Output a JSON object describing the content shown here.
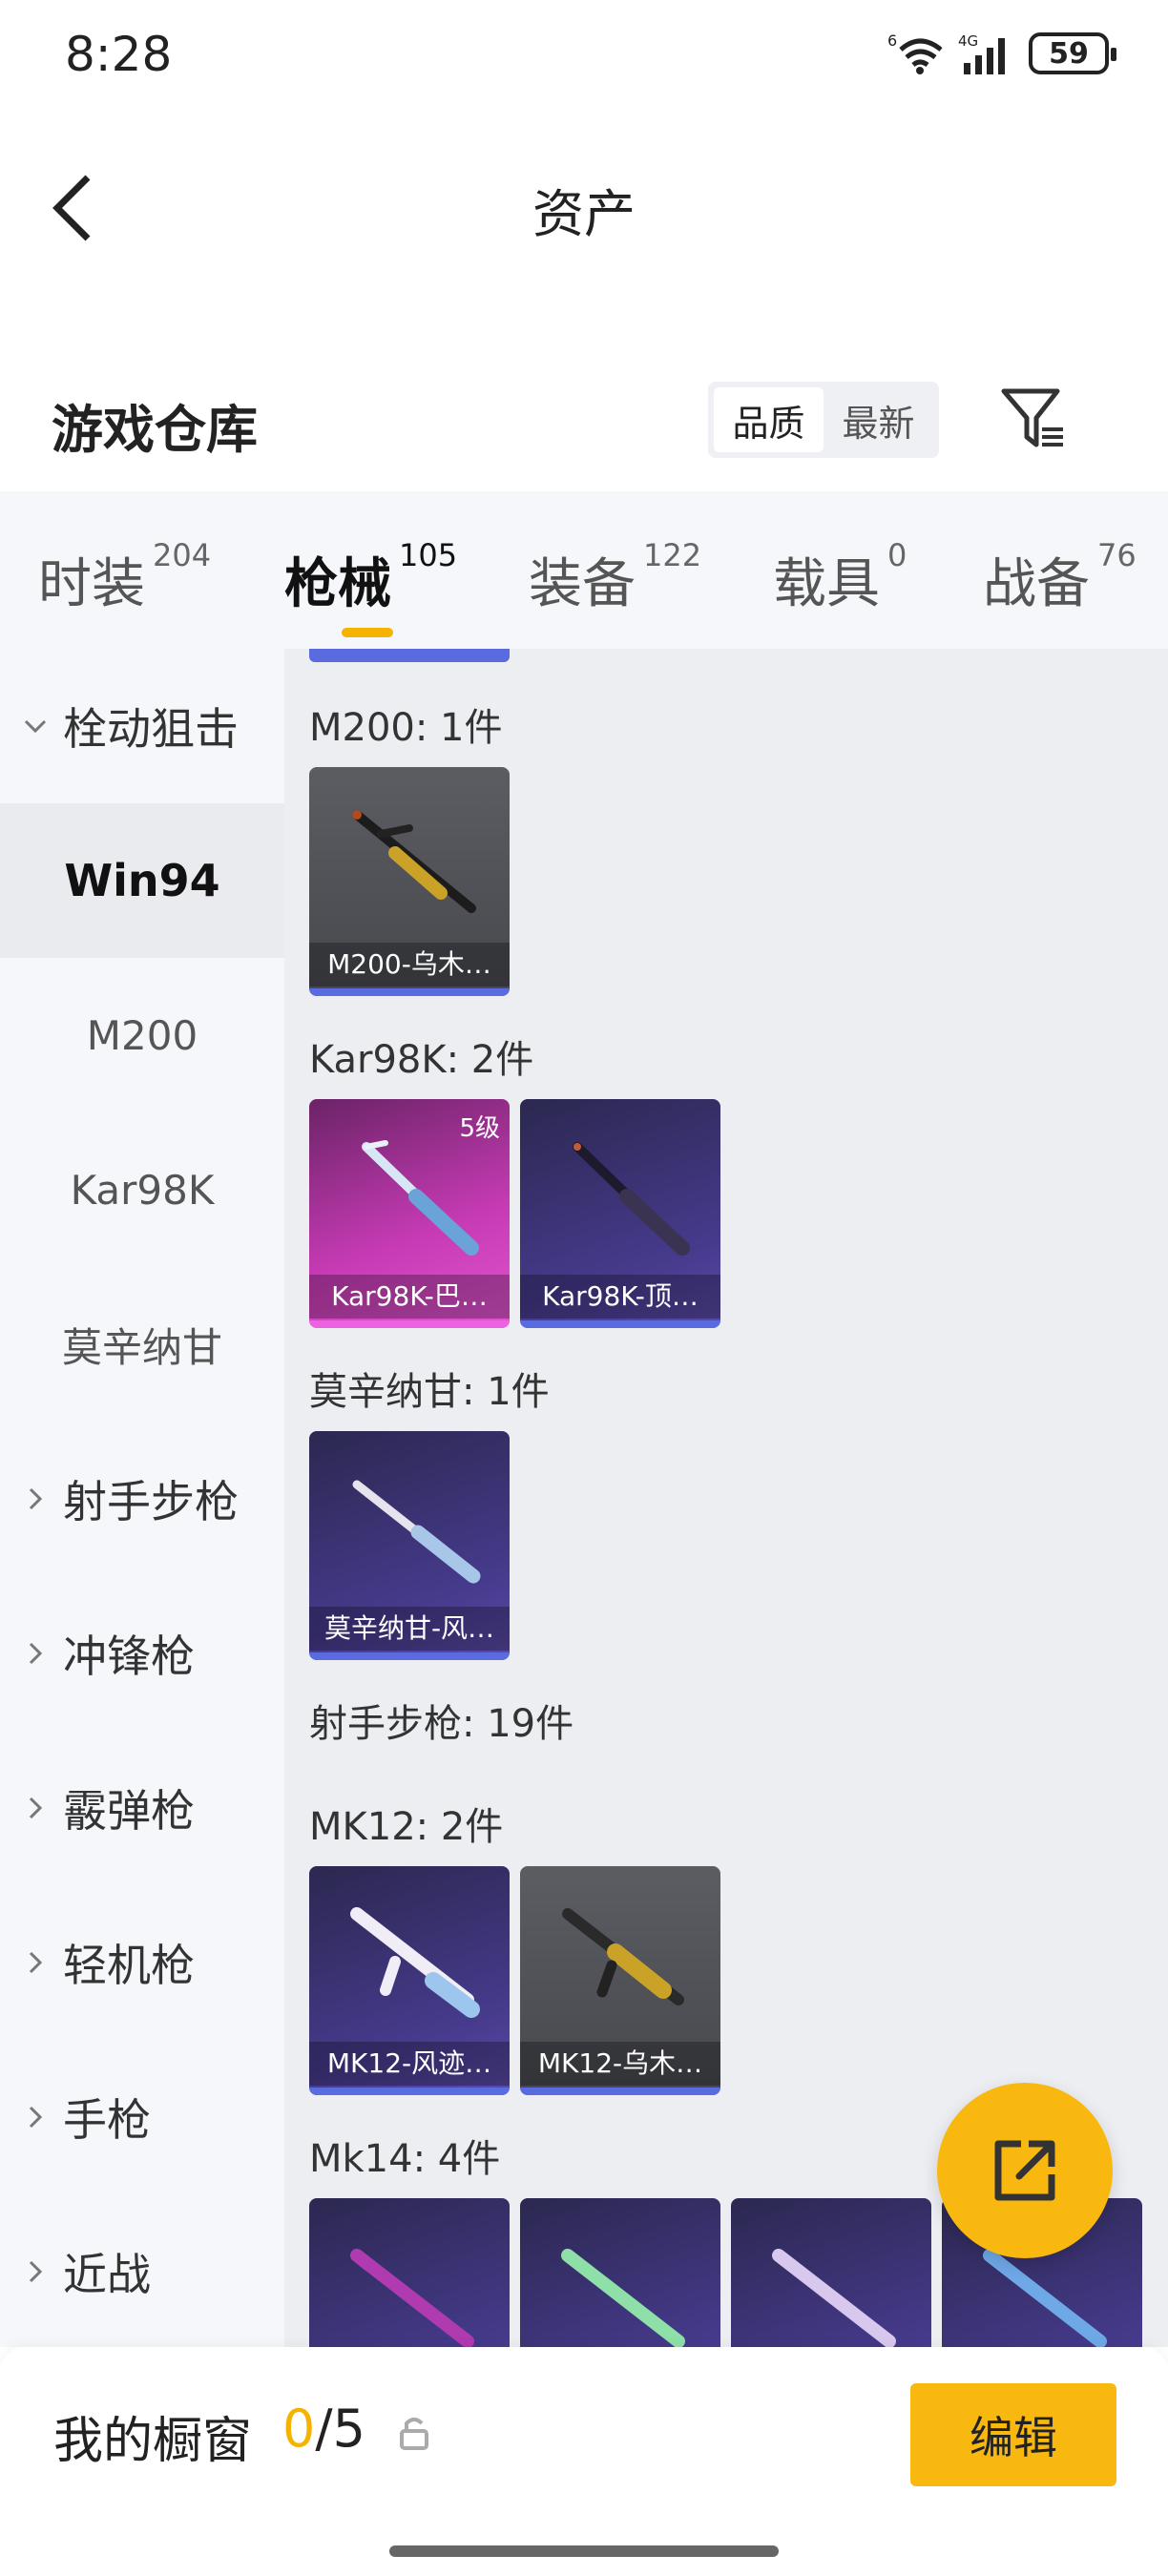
{
  "status_bar": {
    "time": "8:28",
    "battery": "59",
    "wifi_badge": "6",
    "signal_badge": "4G"
  },
  "header": {
    "title": "资产"
  },
  "warehouse": {
    "title": "游戏仓库",
    "sort_options": [
      "品质",
      "最新"
    ],
    "active_sort": "品质"
  },
  "tabs": [
    {
      "label": "时装",
      "count": "204"
    },
    {
      "label": "枪械",
      "count": "105",
      "active": true
    },
    {
      "label": "装备",
      "count": "122"
    },
    {
      "label": "载具",
      "count": "0"
    },
    {
      "label": "战备",
      "count": "76"
    }
  ],
  "sidebar": {
    "groups": [
      {
        "label": "栓动狙击",
        "expanded": true
      },
      {
        "label": "射手步枪"
      },
      {
        "label": "冲锋枪"
      },
      {
        "label": "霰弹枪"
      },
      {
        "label": "轻机枪"
      },
      {
        "label": "手枪"
      },
      {
        "label": "近战"
      }
    ],
    "sub_items": [
      "Win94",
      "M200",
      "Kar98K",
      "莫辛纳甘"
    ],
    "selected": "Win94"
  },
  "sections": [
    {
      "title": "M200: 1件",
      "items": [
        {
          "name": "M200-乌木…",
          "rarity": "gray"
        }
      ]
    },
    {
      "title": "Kar98K: 2件",
      "items": [
        {
          "name": "Kar98K-巴…",
          "rarity": "pink",
          "level": "5级"
        },
        {
          "name": "Kar98K-顶…",
          "rarity": "purple"
        }
      ]
    },
    {
      "title": "莫辛纳甘: 1件",
      "items": [
        {
          "name": "莫辛纳甘-风…",
          "rarity": "purple"
        }
      ]
    },
    {
      "title": "射手步枪: 19件"
    },
    {
      "title": "MK12: 2件",
      "items": [
        {
          "name": "MK12-风迹…",
          "rarity": "purple"
        },
        {
          "name": "MK12-乌木…",
          "rarity": "gray"
        }
      ]
    },
    {
      "title": "Mk14: 4件"
    }
  ],
  "bottom": {
    "label": "我的橱窗",
    "current": "0",
    "separator": "/",
    "total": "5",
    "edit_label": "编辑"
  },
  "colors": {
    "accent": "#f8b810",
    "rare_blue": "#5a6be0",
    "legend_pink": "#ec62e0"
  }
}
